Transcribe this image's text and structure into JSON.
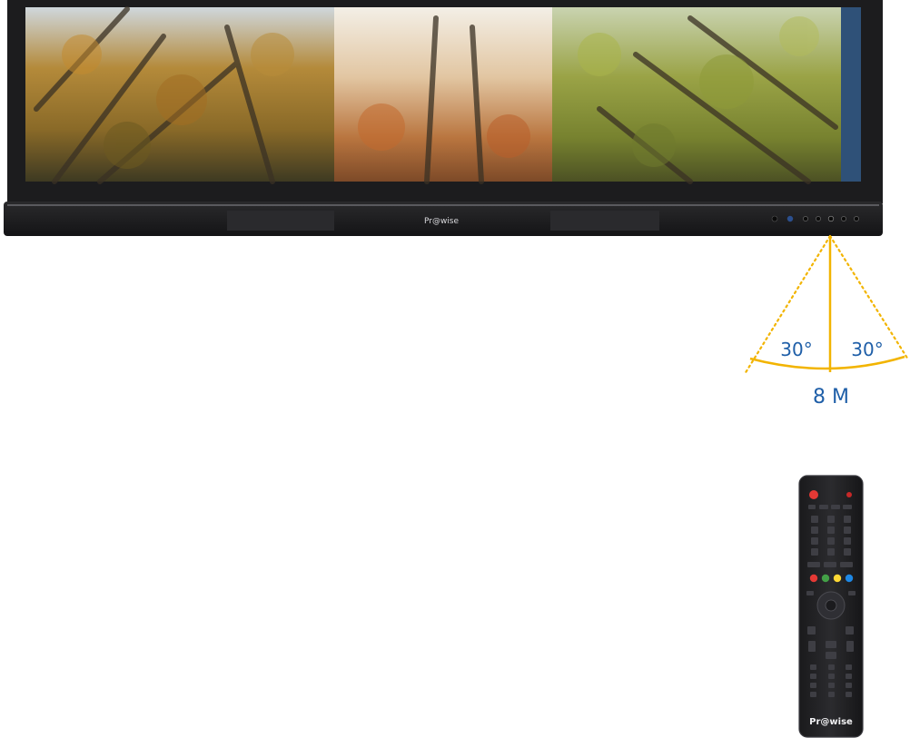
{
  "display": {
    "brand_logo": "Pr@wise",
    "front_buttons": [
      "power",
      "source",
      "menu",
      "vol-down",
      "vol-up",
      "ch-down",
      "ch-up"
    ]
  },
  "range_diagram": {
    "left_angle": "30°",
    "right_angle": "30°",
    "distance": "8 M",
    "color": "#f2b400",
    "label_color": "#1f5fa8"
  },
  "remote": {
    "brand_logo": "Pr@wise",
    "color_keys": [
      "#e53935",
      "#43a047",
      "#fdd835",
      "#1e88e5"
    ]
  }
}
